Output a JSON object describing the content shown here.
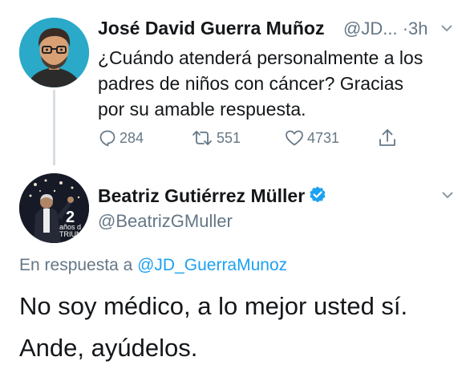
{
  "tweet1": {
    "author_name": "José David Guerra Muñoz",
    "author_handle": "@JD...",
    "separator": "·",
    "time": "3h",
    "text_lines": [
      "¿Cuándo atenderá personalmente a los",
      "padres de niños con cáncer? Gracias",
      "por su amable respuesta."
    ],
    "reply_count": "284",
    "retweet_count": "551",
    "like_count": "4731"
  },
  "tweet2": {
    "author_name": "Beatriz Gutiérrez Müller",
    "author_handle": "@BeatrizGMuller",
    "avatar_badge_number": "2",
    "avatar_badge_text_1": "años d",
    "avatar_badge_text_2": "TRIUN",
    "reply_prefix": "En respuesta a ",
    "reply_to_handle": "@JD_GuerraMunoz",
    "text_lines": [
      "No soy médico, a lo mejor usted sí.",
      "Ande, ayúdelos."
    ]
  },
  "icons": [
    "reply-icon",
    "retweet-icon",
    "like-icon",
    "share-icon",
    "chevron-down-icon",
    "verified-badge-icon"
  ],
  "colors": {
    "accent": "#1da1f2",
    "muted": "#657786",
    "text": "#14171a",
    "thread_line": "#d7dde2"
  }
}
